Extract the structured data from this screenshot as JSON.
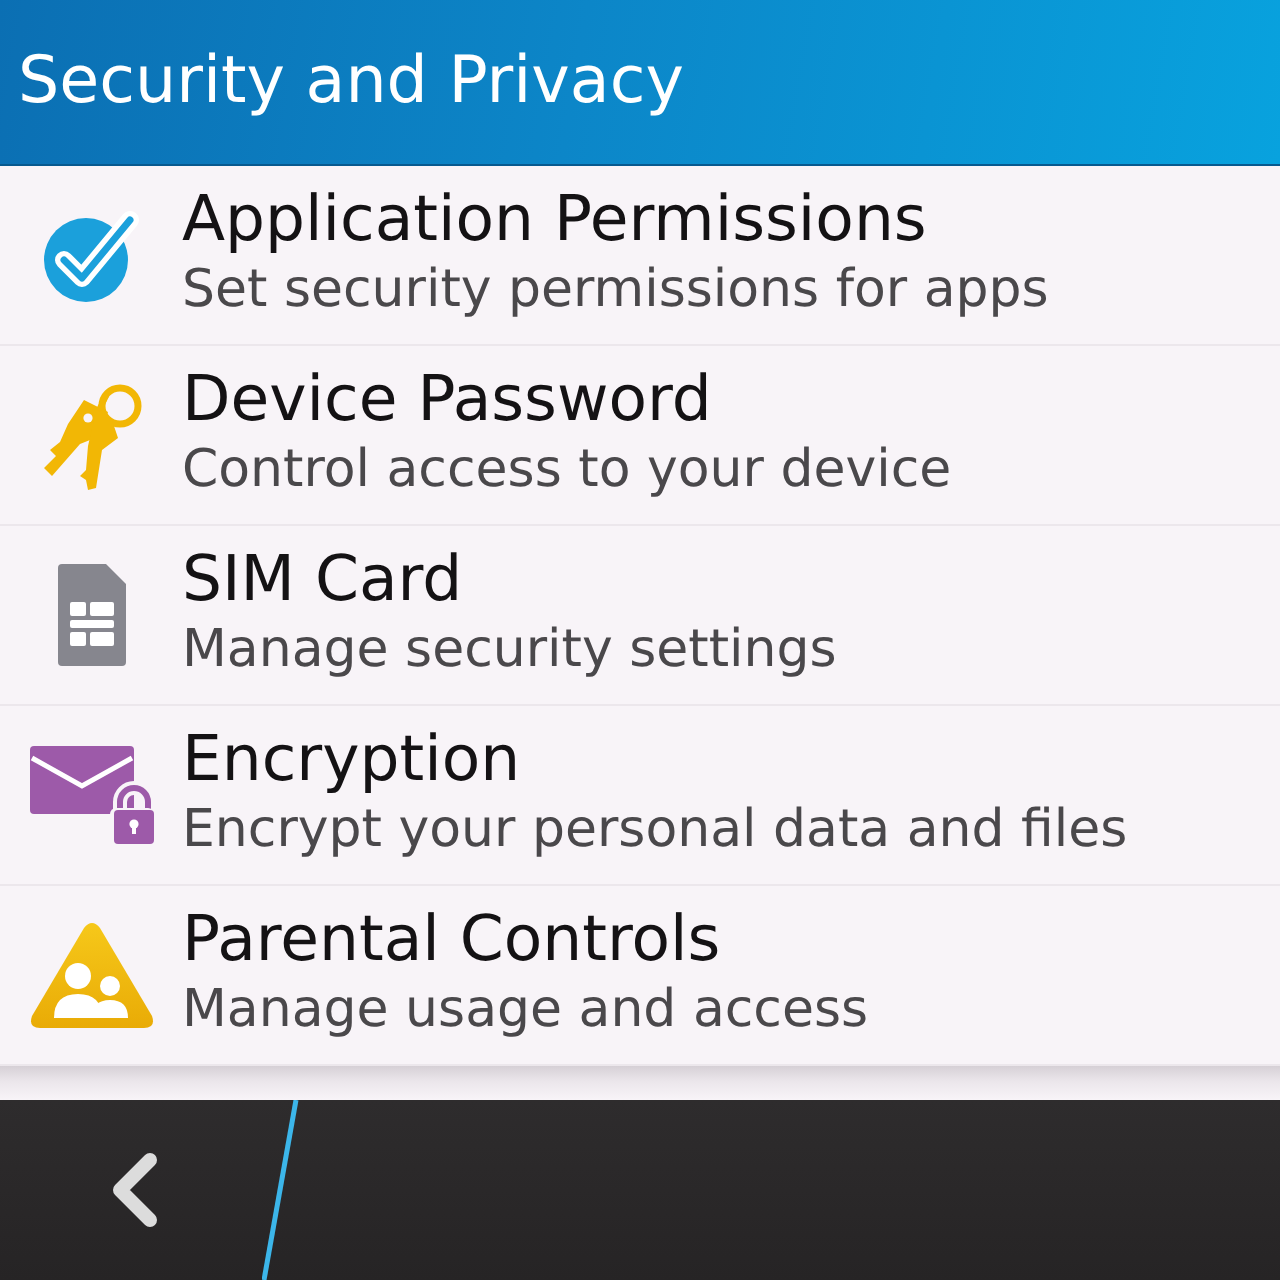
{
  "header": {
    "title": "Security and Privacy"
  },
  "items": [
    {
      "kind": "check",
      "title": "Application Permissions",
      "subtitle": "Set security permissions for apps"
    },
    {
      "kind": "keys",
      "title": "Device Password",
      "subtitle": "Control access to your device"
    },
    {
      "kind": "sim",
      "title": "SIM Card",
      "subtitle": "Manage security settings"
    },
    {
      "kind": "envelope",
      "title": "Encryption",
      "subtitle": "Encrypt your personal data and files"
    },
    {
      "kind": "parental",
      "title": "Parental Controls",
      "subtitle": "Manage usage and access"
    }
  ]
}
